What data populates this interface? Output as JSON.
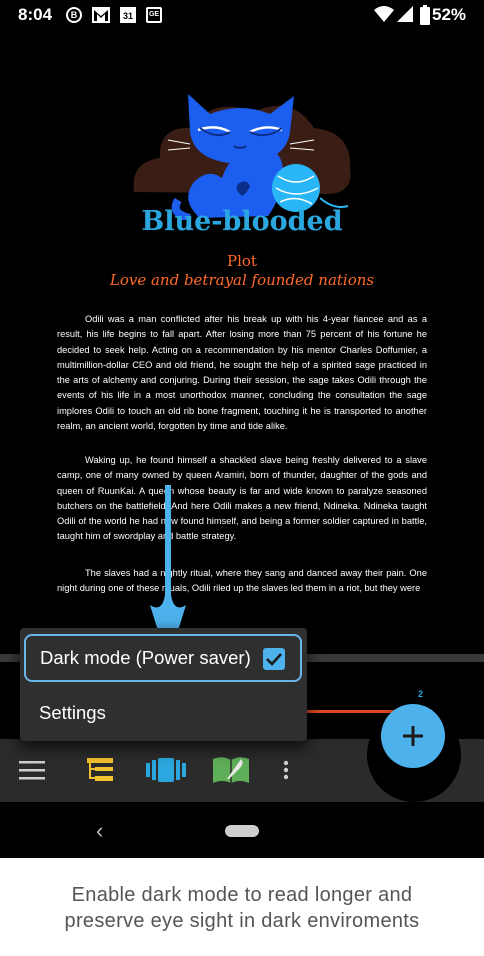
{
  "status_bar": {
    "time": "8:04",
    "battery": "52%",
    "icons": [
      "b-badge-icon",
      "gmail-icon",
      "calendar-icon",
      "ge-icon",
      "wifi-icon",
      "signal-icon",
      "battery-icon"
    ],
    "calendar_day": "31",
    "b_label": "B",
    "ge_label": "GE"
  },
  "reader": {
    "title": "Blue-blooded",
    "chapter": "Plot",
    "subtitle": "Love and betrayal founded nations",
    "paragraphs": [
      "Odili was a man conflicted after his break up with his 4-year fiancee and as a result, his life begins to fall apart. After losing more than 75 percent of his fortune he decided to seek help. Acting on a recommendation by his mentor Charles Doffumier, a multimillion-dollar CEO and old friend, he sought the help of a spirited sage practiced in the arts of alchemy and conjuring. During their session, the sage takes Odili through the events of his life in a most unorthodox manner, concluding the consultation the sage implores Odili to touch an old rib bone fragment, touching it he is transported to another realm, an ancient world, forgotten by time and tide alike.",
      "Waking up, he found himself a shackled slave being freshly delivered to a slave camp, one of many owned by queen Aramiri, born of thunder, daughter of the gods and queen of RuunKai. A queen whose beauty is far and wide known to paralyze seasoned butchers on the battlefield. And here Odili makes a new friend, Ndineka. Ndineka taught Odili of the world he had now found himself, and being a former soldier captured in battle, taught him of swordplay and battle strategy.",
      "The slaves had a nightly ritual, where they sang and danced away their pain. One night during one of these rituals, Odili riled up the slaves led them in a riot, but they were"
    ],
    "progress_fraction": 0.2,
    "count": "2"
  },
  "popup_menu": {
    "dark_mode_label": "Dark mode (Power saver)",
    "dark_mode_checked": true,
    "settings_label": "Settings"
  },
  "toolbar": {
    "icons": [
      "hamburger-menu-icon",
      "outline-icon",
      "cards-icon",
      "book-icon",
      "more-vert-icon"
    ],
    "fab_icon": "plus-icon"
  },
  "caption": {
    "line1": "Enable dark mode to read longer and",
    "line2": "preserve eye sight in dark enviroments"
  },
  "colors": {
    "accent_blue": "#4db1ec",
    "title_blue": "#2aa7de",
    "orange": "#ff6a2a",
    "toolbar_bg": "#2b2b2b"
  }
}
